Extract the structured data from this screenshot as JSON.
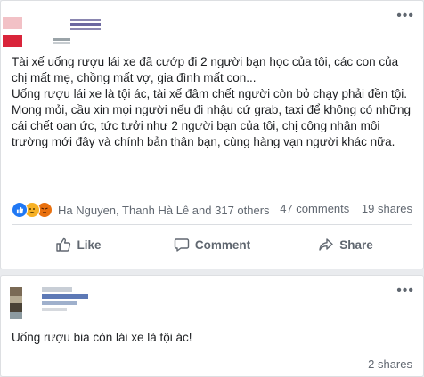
{
  "post1": {
    "paragraphs": [
      "Tài xế uống rượu lái xe đã cướp đi 2 người bạn học của tôi, các con của chị mất mẹ, chồng mất vợ, gia đình mất con...",
      "Uống rượu lái xe là tội ác, tài xế đâm chết người còn bỏ chạy phải đền tội.",
      "Mong mỏi, cầu xin mọi người nếu đi nhậu cứ grab, taxi để không có những cái chết oan ức, tức tưởi như 2 người bạn của tôi, chị công nhân môi trường mới đây và chính bản thân bạn, cùng hàng vạn người khác nữa."
    ],
    "reactions": {
      "icons": [
        "like-reaction",
        "sad-reaction",
        "angry-reaction"
      ],
      "names": "Ha Nguyen, Thanh Hà Lê and 317 others"
    },
    "comments": "47 comments",
    "shares": "19 shares",
    "actions": {
      "like": "Like",
      "comment": "Comment",
      "share": "Share"
    }
  },
  "post2": {
    "text": "Uống rượu bia còn lái xe là tội ác!",
    "shares": "2 shares"
  },
  "ui": {
    "menu_glyph": "•••",
    "accent": "#606770"
  }
}
